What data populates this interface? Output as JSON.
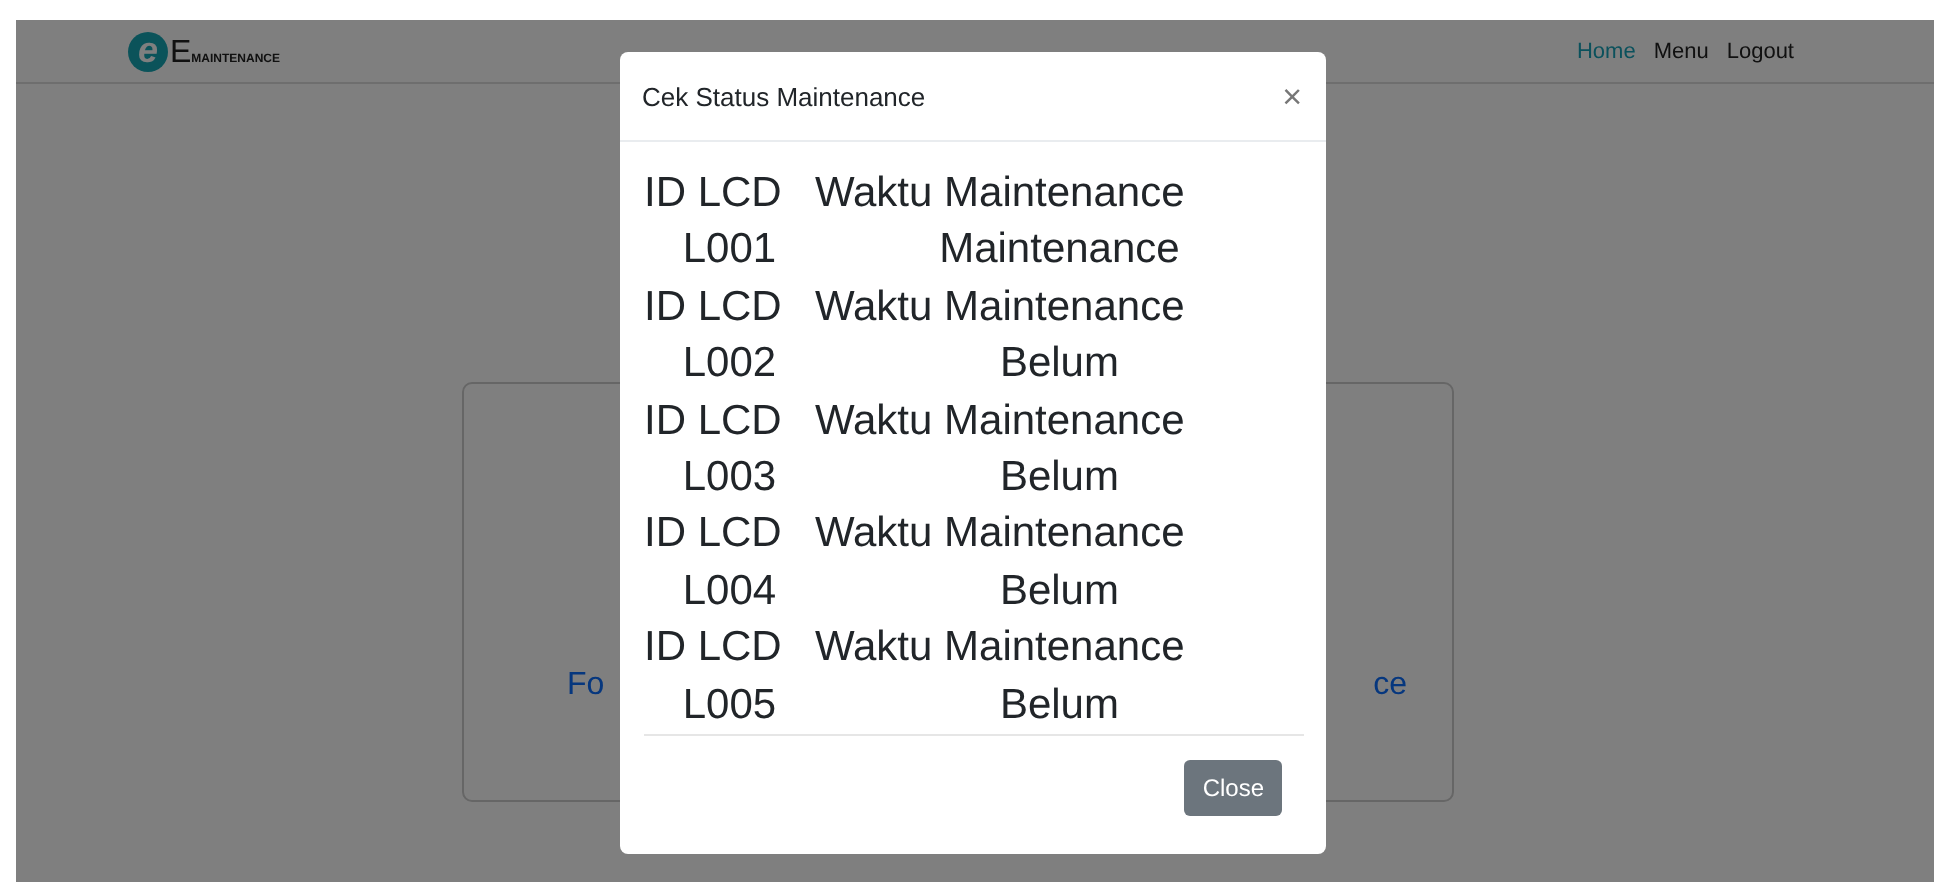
{
  "brand": {
    "initial": "e",
    "letter": "E",
    "word": "MAINTENANCE"
  },
  "nav": [
    {
      "label": "Home",
      "selected": true
    },
    {
      "label": "Menu",
      "selected": false
    },
    {
      "label": "Logout",
      "selected": false
    }
  ],
  "card": {
    "text_left": "Fo",
    "text_right": "ce"
  },
  "modal": {
    "title": "Cek Status Maintenance",
    "close_icon": "×",
    "records": [
      {
        "headers": [
          "ID LCD",
          "Waktu Maintenance"
        ],
        "cells": [
          "L001",
          "Maintenance"
        ]
      },
      {
        "headers": [
          "ID LCD",
          "Waktu Maintenance"
        ],
        "cells": [
          "L002",
          "Belum"
        ]
      },
      {
        "headers": [
          "ID LCD",
          "Waktu Maintenance"
        ],
        "cells": [
          "L003",
          "Belum"
        ]
      },
      {
        "headers": [
          "ID LCD",
          "Waktu Maintenance"
        ],
        "cells": [
          "L004",
          "Belum"
        ]
      },
      {
        "headers": [
          "ID LCD",
          "Waktu Maintenance"
        ],
        "cells": [
          "L005",
          "Belum"
        ]
      }
    ],
    "button": "Close"
  }
}
